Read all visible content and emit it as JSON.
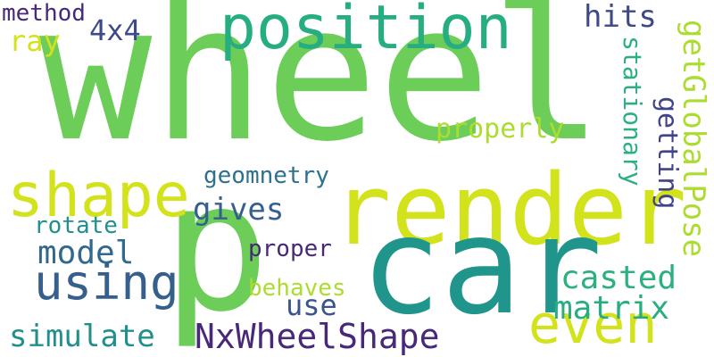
{
  "words": {
    "wheel": "wheel",
    "p": "p",
    "render": "render",
    "car": "car",
    "shape": "shape",
    "position": "position",
    "even": "even",
    "using": "using",
    "geomnetry": "geomnetry",
    "gives": "gives",
    "rotate": "rotate",
    "model": "model",
    "proper": "proper",
    "behaves": "behaves",
    "use": "use",
    "simulate": "simulate",
    "NxWheelShape": "NxWheelShape",
    "casted": "casted",
    "matrix": "matrix",
    "properly": "properly",
    "method": "method",
    "ray": "ray",
    "x4": "4x4",
    "hits": "hits",
    "getting": "getting",
    "stationary": "stationary",
    "getGlobalPose": "getGlobalPose"
  },
  "colors": {
    "lime": "#6cce59",
    "yellow": "#d2e21b",
    "yellow_green": "#addc30",
    "green": "#26ad81",
    "teal": "#1f958b",
    "navy": "#414487",
    "purple": "#482878",
    "blue": "#355f8d"
  }
}
